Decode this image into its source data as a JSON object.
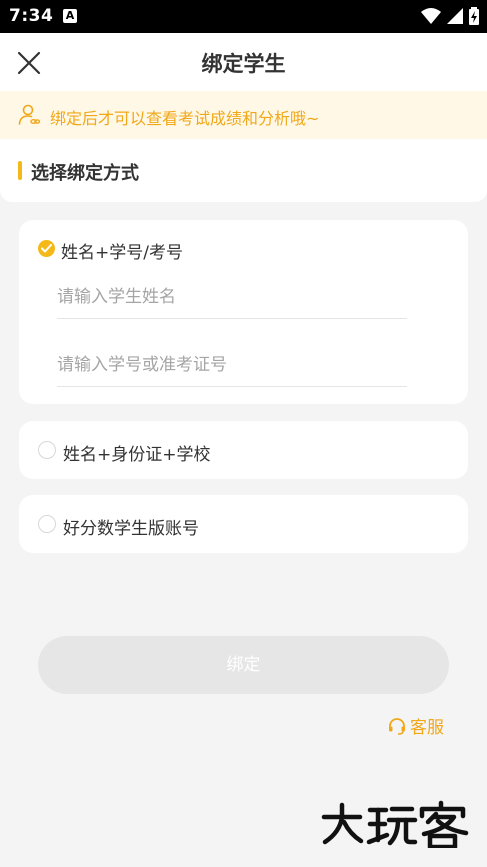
{
  "status_bar": {
    "time": "7:34",
    "notification_icon_letter": "A"
  },
  "nav": {
    "title": "绑定学生"
  },
  "notice": {
    "text": "绑定后才可以查看考试成绩和分析哦~"
  },
  "section": {
    "title": "选择绑定方式"
  },
  "options": [
    {
      "label": "姓名+学号/考号",
      "selected": true,
      "fields": [
        {
          "placeholder": "请输入学生姓名",
          "value": ""
        },
        {
          "placeholder": "请输入学号或准考证号",
          "value": ""
        }
      ]
    },
    {
      "label": "姓名+身份证+学校",
      "selected": false
    },
    {
      "label": "好分数学生版账号",
      "selected": false
    }
  ],
  "bind_button": {
    "label": "绑定"
  },
  "service": {
    "label": "客服"
  },
  "watermark": {
    "text": "大玩客"
  },
  "colors": {
    "accent": "#f4b818",
    "notice_text": "#f0a81a",
    "notice_bg": "#fff8e6",
    "button_disabled": "#e6e6e6"
  }
}
